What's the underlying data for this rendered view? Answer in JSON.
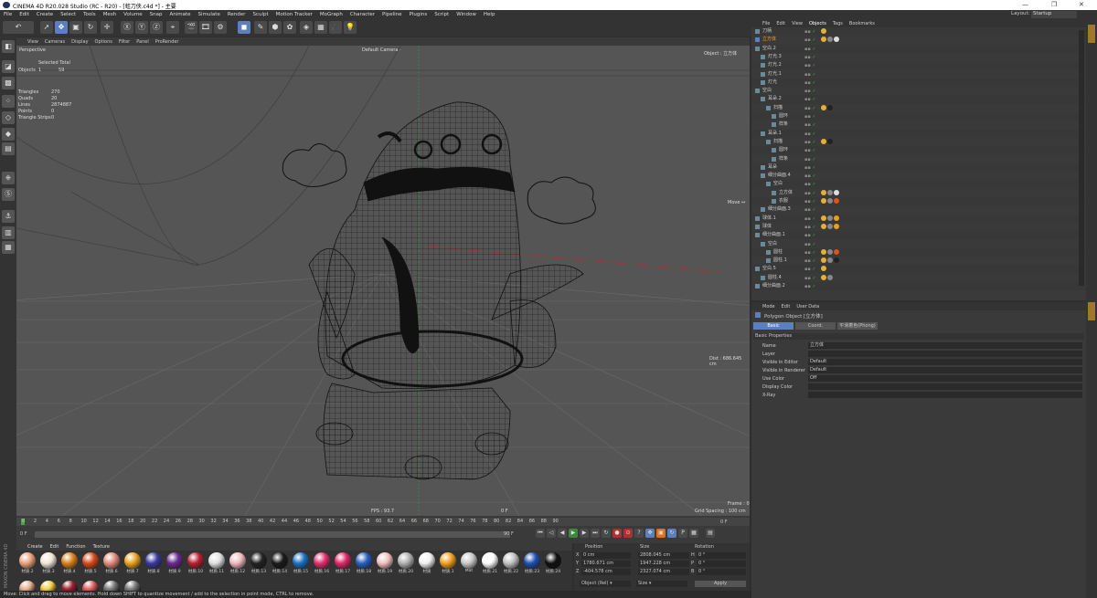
{
  "window": {
    "title": "CINEMA 4D R20.028 Studio (RC - R20) - [蛙刀侠.c4d *] - 主要",
    "minimize": "—",
    "maximize": "❐",
    "close": "✕"
  },
  "menubar": [
    "File",
    "Edit",
    "Create",
    "Select",
    "Tools",
    "Mesh",
    "Volume",
    "Snap",
    "Animate",
    "Simulate",
    "Render",
    "Sculpt",
    "Motion Tracker",
    "MoGraph",
    "Character",
    "Pipeline",
    "Plugins",
    "Script",
    "Window",
    "Help"
  ],
  "layout": {
    "label": "Layout:",
    "value": "Startup"
  },
  "viewport": {
    "menu": [
      "View",
      "Cameras",
      "Display",
      "Options",
      "Filter",
      "Panel",
      "ProRender"
    ],
    "name": "Perspective",
    "camera": "Default Camera ·",
    "object_label": "Object : 立方体",
    "selected_total": "Selected Total",
    "objects_label": "Objects",
    "objects_a": "1",
    "objects_b": "59",
    "stats": [
      {
        "label": "Triangles",
        "value": "270"
      },
      {
        "label": "Quads",
        "value": "20"
      },
      {
        "label": "Lines",
        "value": "2874887"
      },
      {
        "label": "Points",
        "value": "0"
      },
      {
        "label": "Triangle Strips",
        "value": "0"
      }
    ],
    "move": "Move ↔",
    "dist": "Dist : 686.645 cm",
    "fps": "FPS : 93.7",
    "frame_f": "0 F",
    "grid": "Grid Spacing : 100 cm",
    "frame": "Frame : 0"
  },
  "timeline": {
    "ticks": [
      "0",
      "2",
      "4",
      "6",
      "8",
      "10",
      "12",
      "14",
      "16",
      "18",
      "20",
      "22",
      "24",
      "26",
      "28",
      "30",
      "32",
      "34",
      "36",
      "38",
      "40",
      "42",
      "44",
      "46",
      "48",
      "50",
      "52",
      "54",
      "56",
      "58",
      "60",
      "62",
      "64",
      "66",
      "68",
      "70",
      "72",
      "74",
      "76",
      "78",
      "80",
      "82",
      "84",
      "86",
      "88",
      "90"
    ],
    "start": "0 F",
    "end": "90 F",
    "cur": "0 F",
    "max": "90 F",
    "right_f": "0 F"
  },
  "materials": {
    "tabs": [
      "Create",
      "Edit",
      "Function",
      "Texture"
    ],
    "row1": [
      {
        "name": "材质.2",
        "color": "#e9a27a"
      },
      {
        "name": "材质.3",
        "color": "#f0e6da"
      },
      {
        "name": "材质.4",
        "color": "#d9801a"
      },
      {
        "name": "材质.5",
        "color": "#d8491a"
      },
      {
        "name": "材质.6",
        "color": "#e08a7a"
      },
      {
        "name": "材质.7",
        "color": "#e8a020"
      },
      {
        "name": "材质.8",
        "color": "#3a3aa0"
      },
      {
        "name": "材质.9",
        "color": "#6a2a90"
      },
      {
        "name": "材质.10",
        "color": "#b82030"
      },
      {
        "name": "材质.11",
        "color": "#e0e0e0"
      },
      {
        "name": "材质.12",
        "color": "#f0b8c0"
      },
      {
        "name": "材质.13",
        "color": "#222222"
      },
      {
        "name": "材质.14",
        "color": "#1a1a1a"
      },
      {
        "name": "材质.15",
        "color": "#1a70c0"
      },
      {
        "name": "材质.16",
        "color": "#e03070"
      },
      {
        "name": "材质.17",
        "color": "#e02868"
      },
      {
        "name": "材质.18",
        "color": "#2a60c0"
      },
      {
        "name": "材质.19",
        "color": "#f0c0c0"
      },
      {
        "name": "材质.20",
        "color": "#b0b0b0"
      },
      {
        "name": "材质",
        "color": "#f0f0f0"
      },
      {
        "name": "材质.1",
        "color": "#f0a020"
      },
      {
        "name": "Mat",
        "color": "#c8c8c8"
      },
      {
        "name": "材质.21",
        "color": "#ffffff"
      },
      {
        "name": "材质.22",
        "color": "#c0c0c0"
      },
      {
        "name": "材质.23",
        "color": "#2050b0"
      },
      {
        "name": "材质.24",
        "color": "#101010"
      }
    ],
    "row2_colors": [
      "#e8b090",
      "#f4d040",
      "#a02030",
      "#e06060",
      "#7a7a7a",
      "#7a7a7a"
    ]
  },
  "coords": {
    "headers": [
      "Position",
      "Size",
      "Rotation"
    ],
    "rows": [
      {
        "axis": "X",
        "pos": "0 cm",
        "size": "2808.045 cm",
        "rot_axis": "H",
        "rot": "0 °"
      },
      {
        "axis": "Y",
        "pos": "1780.671 cm",
        "size": "1947.228 cm",
        "rot_axis": "P",
        "rot": "0 °"
      },
      {
        "axis": "Z",
        "pos": "-404.578 cm",
        "size": "2327.074 cm",
        "rot_axis": "B",
        "rot": "0 °"
      }
    ],
    "mode": "Object (Rel) ▾",
    "size_mode": "Size ▾",
    "apply": "Apply"
  },
  "objects": {
    "menu": [
      "File",
      "Edit",
      "View",
      "Objects",
      "Tags",
      "Bookmarks"
    ],
    "rows": [
      {
        "indent": 0,
        "name": "刀柄",
        "tags": [
          "#e8b030"
        ],
        "sel": false
      },
      {
        "indent": 0,
        "name": "立方体",
        "tags": [
          "#e8b030",
          "#888",
          "#ddd"
        ],
        "sel": true
      },
      {
        "indent": 0,
        "name": "空白.2",
        "tags": [],
        "sel": false
      },
      {
        "indent": 1,
        "name": "灯光.3",
        "tags": [],
        "sel": false
      },
      {
        "indent": 1,
        "name": "灯光.2",
        "tags": [],
        "sel": false
      },
      {
        "indent": 1,
        "name": "灯光.1",
        "tags": [],
        "sel": false
      },
      {
        "indent": 1,
        "name": "灯光",
        "tags": [],
        "sel": false
      },
      {
        "indent": 0,
        "name": "空白",
        "tags": [],
        "sel": false
      },
      {
        "indent": 1,
        "name": "耳朵.2",
        "tags": [],
        "sel": false
      },
      {
        "indent": 2,
        "name": "扫描",
        "tags": [
          "#e8b030",
          "#222"
        ],
        "sel": false
      },
      {
        "indent": 3,
        "name": "圆环",
        "tags": [],
        "sel": false
      },
      {
        "indent": 3,
        "name": "样条",
        "tags": [],
        "sel": false
      },
      {
        "indent": 1,
        "name": "耳朵.1",
        "tags": [],
        "sel": false
      },
      {
        "indent": 2,
        "name": "扫描",
        "tags": [
          "#e8b030",
          "#222"
        ],
        "sel": false
      },
      {
        "indent": 3,
        "name": "圆环",
        "tags": [],
        "sel": false
      },
      {
        "indent": 3,
        "name": "样条",
        "tags": [],
        "sel": false
      },
      {
        "indent": 1,
        "name": "耳朵",
        "tags": [],
        "sel": false
      },
      {
        "indent": 1,
        "name": "细分曲面.4",
        "tags": [],
        "sel": false
      },
      {
        "indent": 2,
        "name": "空白",
        "tags": [],
        "sel": false
      },
      {
        "indent": 3,
        "name": "立方体",
        "tags": [
          "#e8b030",
          "#888",
          "#ddd"
        ],
        "sel": false
      },
      {
        "indent": 3,
        "name": "衣服",
        "tags": [
          "#e8b030",
          "#888",
          "#e05020"
        ],
        "sel": false
      },
      {
        "indent": 1,
        "name": "细分曲面.3",
        "tags": [],
        "sel": false
      },
      {
        "indent": 0,
        "name": "球体.1",
        "tags": [
          "#e8b030",
          "#888",
          "#e8a020"
        ],
        "sel": false
      },
      {
        "indent": 0,
        "name": "球体",
        "tags": [
          "#e8b030",
          "#888",
          "#e8a020"
        ],
        "sel": false
      },
      {
        "indent": 0,
        "name": "细分曲面.1",
        "tags": [],
        "sel": false
      },
      {
        "indent": 1,
        "name": "空白",
        "tags": [],
        "sel": false
      },
      {
        "indent": 2,
        "name": "圆柱",
        "tags": [
          "#e8b030",
          "#888",
          "#e05020"
        ],
        "sel": false
      },
      {
        "indent": 2,
        "name": "圆柱.1",
        "tags": [
          "#e8b030",
          "#888",
          "#222"
        ],
        "sel": false
      },
      {
        "indent": 0,
        "name": "空白.5",
        "tags": [
          "#e8b030"
        ],
        "sel": false
      },
      {
        "indent": 1,
        "name": "圆柱.4",
        "tags": [
          "#e8b030",
          "#888"
        ],
        "sel": false
      },
      {
        "indent": 0,
        "name": "细分曲面.2",
        "tags": [],
        "sel": false
      }
    ]
  },
  "attributes": {
    "menu": [
      "Mode",
      "Edit",
      "User Data"
    ],
    "object_title": "Polygon Object [立方体]",
    "tabs": [
      "Basic",
      "Coord.",
      "平滑着色(Phong)"
    ],
    "section": "Basic Properties",
    "fields": [
      {
        "label": "Name",
        "value": "立方体"
      },
      {
        "label": "Layer",
        "value": ""
      },
      {
        "label": "Visible in Editor",
        "value": "Default"
      },
      {
        "label": "Visible in Renderer",
        "value": "Default"
      },
      {
        "label": "Use Color",
        "value": "Off"
      },
      {
        "label": "Display Color",
        "value": ""
      },
      {
        "label": "X-Ray",
        "value": ""
      }
    ]
  },
  "status": "Move: Click and drag to move elements. Hold down SHIFT to quantize movement / add to the selection in point mode, CTRL to remove.",
  "brand": "MAXON CINEMA 4D"
}
